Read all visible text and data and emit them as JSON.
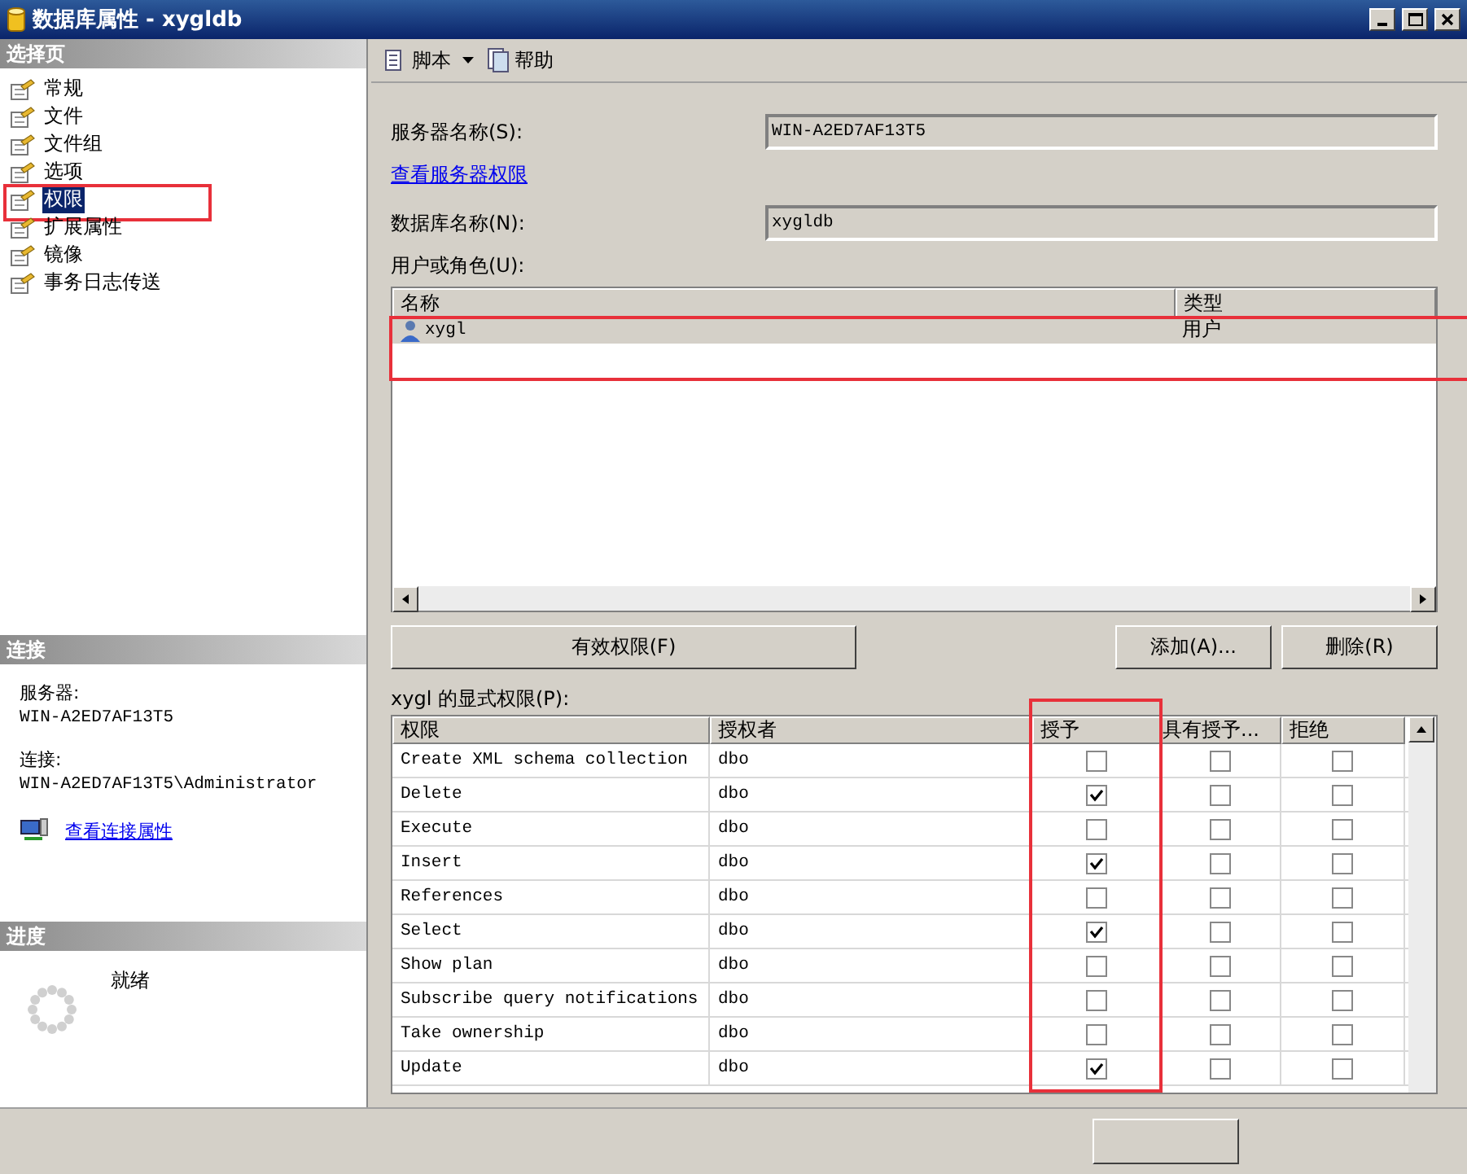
{
  "window": {
    "title": "数据库属性 - xygldb"
  },
  "sidebar": {
    "header": "选择页",
    "items": [
      {
        "label": "常规",
        "selected": false,
        "highlighted": false
      },
      {
        "label": "文件",
        "selected": false,
        "highlighted": false
      },
      {
        "label": "文件组",
        "selected": false,
        "highlighted": false
      },
      {
        "label": "选项",
        "selected": false,
        "highlighted": false
      },
      {
        "label": "权限",
        "selected": true,
        "highlighted": true
      },
      {
        "label": "扩展属性",
        "selected": false,
        "highlighted": false
      },
      {
        "label": "镜像",
        "selected": false,
        "highlighted": false
      },
      {
        "label": "事务日志传送",
        "selected": false,
        "highlighted": false
      }
    ]
  },
  "connection": {
    "header": "连接",
    "server_label": "服务器:",
    "server": "WIN-A2ED7AF13T5",
    "connection_label": "连接:",
    "connection": "WIN-A2ED7AF13T5\\Administrator",
    "link": "查看连接属性"
  },
  "progress": {
    "header": "进度",
    "status": "就绪"
  },
  "toolbar": [
    {
      "label": "脚本",
      "kind": "dropdown"
    },
    {
      "label": "帮助",
      "kind": "plain"
    }
  ],
  "server_name": {
    "label": "服务器名称(S):",
    "value": "WIN-A2ED7AF13T5"
  },
  "server_permissions_link": "查看服务器权限",
  "database_name": {
    "label": "数据库名称(N):",
    "value": "xygldb"
  },
  "users": {
    "label": "用户或角色(U):",
    "highlighted": true,
    "columns": [
      "名称",
      "类型"
    ],
    "rows": [
      {
        "name": "xygl",
        "type": "用户",
        "selected": true
      }
    ]
  },
  "buttons": {
    "effective": "有效权限(F)",
    "add": "添加(A)...",
    "remove": "删除(R)"
  },
  "permissions": {
    "label": "xygl 的显式权限(P):",
    "columns": [
      "权限",
      "授权者",
      "授予",
      "具有授予...",
      "拒绝"
    ],
    "grant_highlighted": true,
    "rows": [
      {
        "name": "Create XML schema collection",
        "grantor": "dbo",
        "grant": false,
        "with_grant": false,
        "deny": false
      },
      {
        "name": "Delete",
        "grantor": "dbo",
        "grant": true,
        "with_grant": false,
        "deny": false
      },
      {
        "name": "Execute",
        "grantor": "dbo",
        "grant": false,
        "with_grant": false,
        "deny": false
      },
      {
        "name": "Insert",
        "grantor": "dbo",
        "grant": true,
        "with_grant": false,
        "deny": false
      },
      {
        "name": "References",
        "grantor": "dbo",
        "grant": false,
        "with_grant": false,
        "deny": false
      },
      {
        "name": "Select",
        "grantor": "dbo",
        "grant": true,
        "with_grant": false,
        "deny": false
      },
      {
        "name": "Show plan",
        "grantor": "dbo",
        "grant": false,
        "with_grant": false,
        "deny": false
      },
      {
        "name": "Subscribe query notifications",
        "grantor": "dbo",
        "grant": false,
        "with_grant": false,
        "deny": false
      },
      {
        "name": "Take ownership",
        "grantor": "dbo",
        "grant": false,
        "with_grant": false,
        "deny": false
      },
      {
        "name": "Update",
        "grantor": "dbo",
        "grant": true,
        "with_grant": false,
        "deny": false
      }
    ]
  }
}
